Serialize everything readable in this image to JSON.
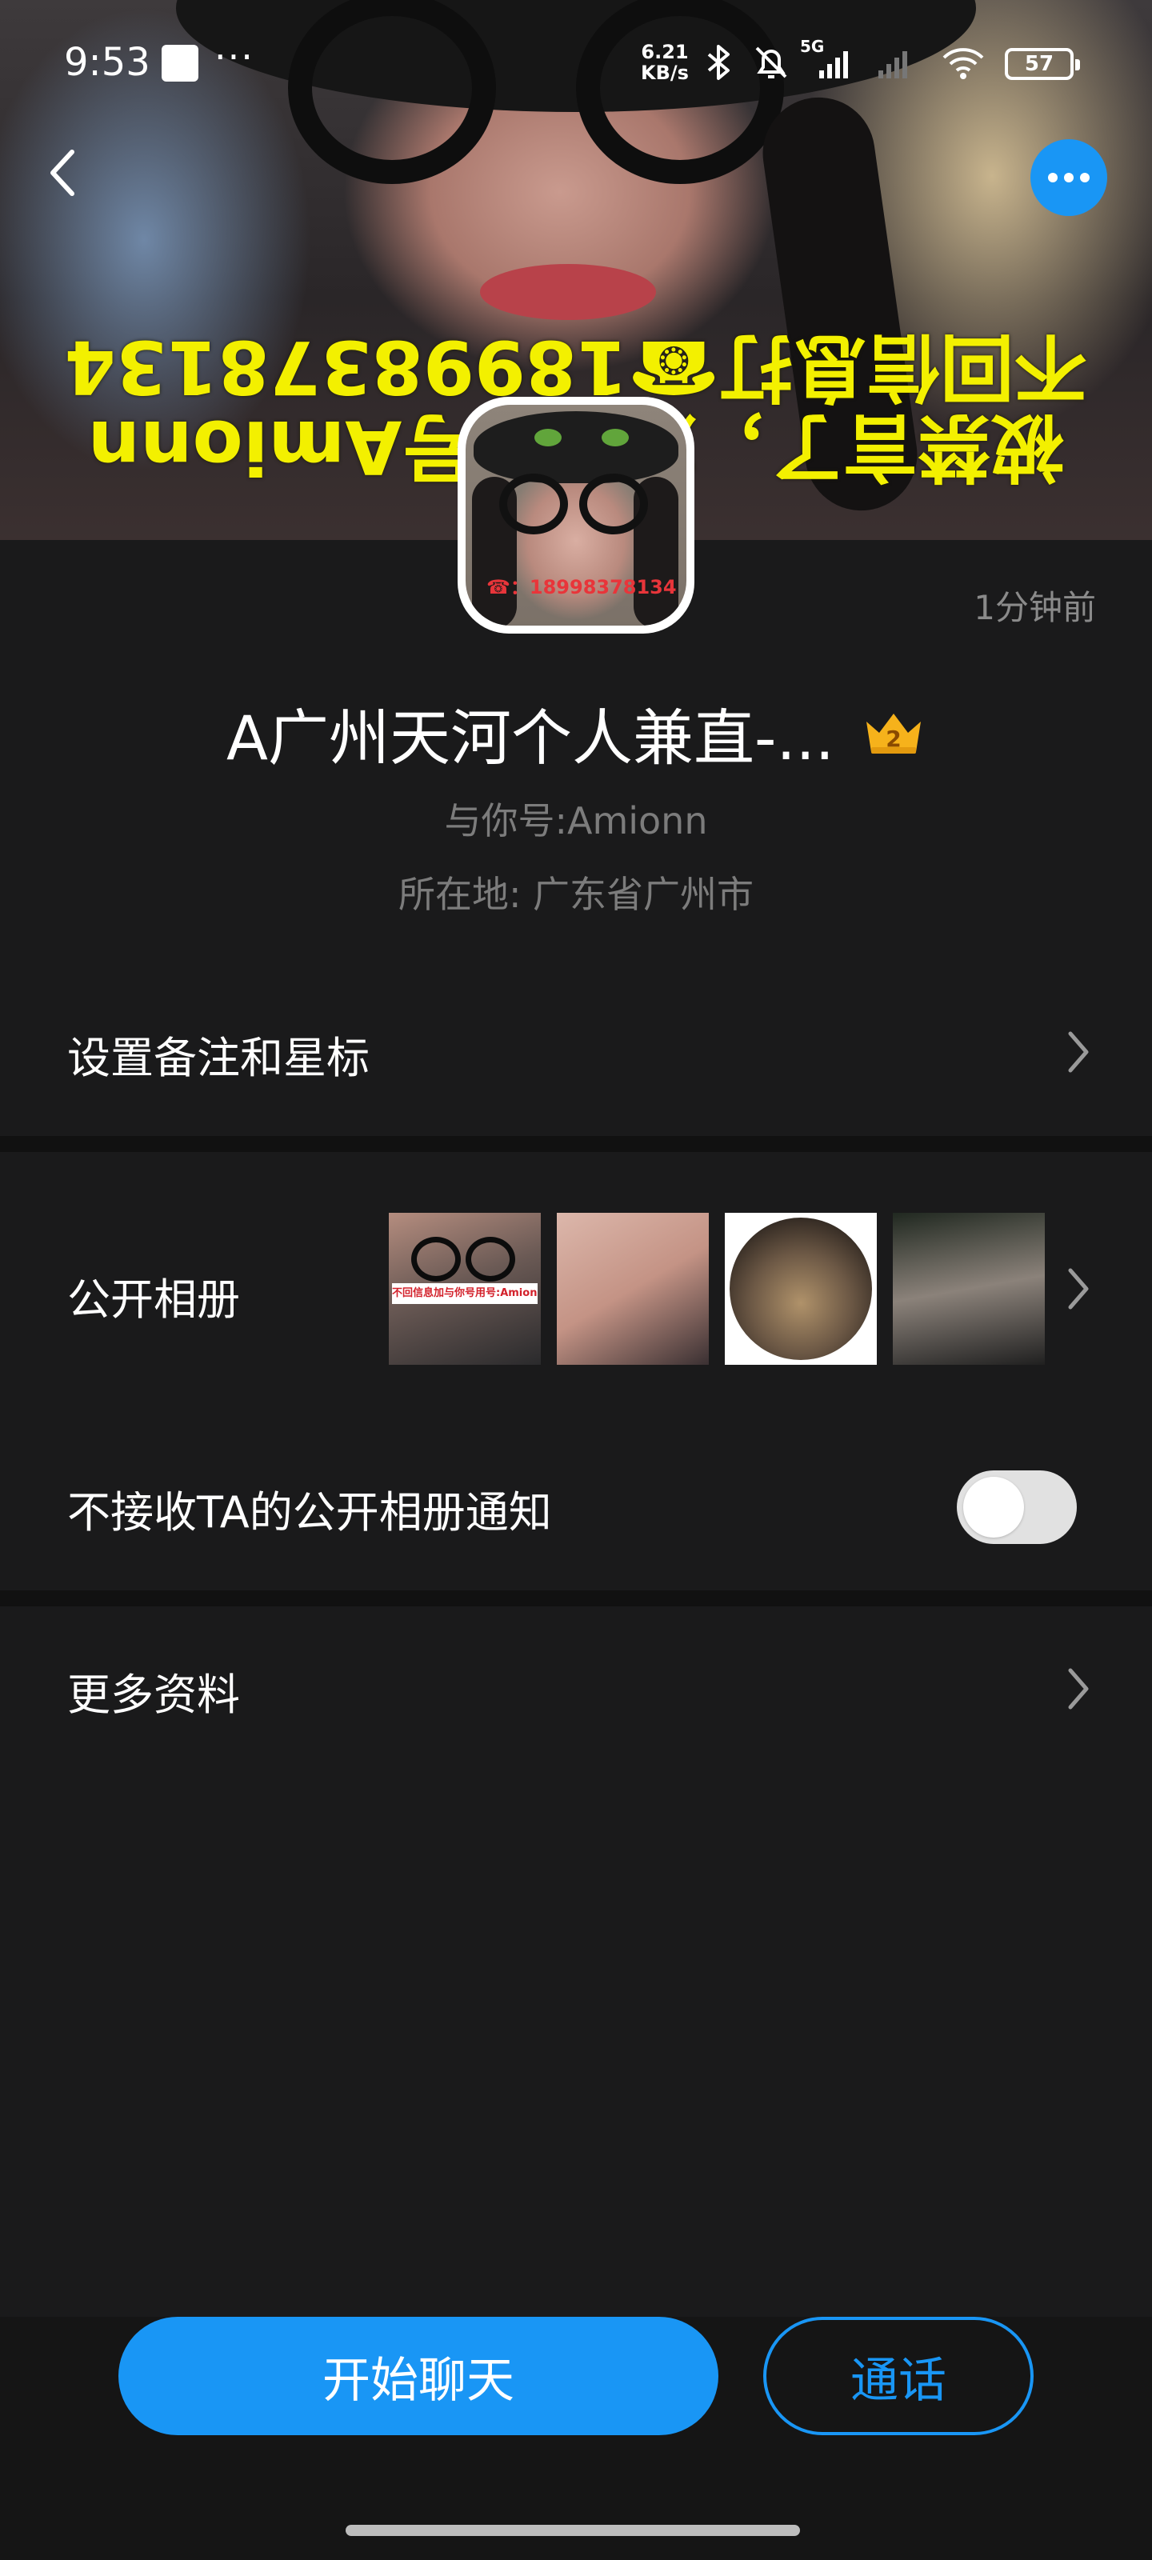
{
  "status_bar": {
    "time": "9:53",
    "dots": "···",
    "net_speed_value": "6.21",
    "net_speed_unit": "KB/s",
    "network": "5G",
    "battery": "57"
  },
  "cover": {
    "overlay_line1": "被禁言了，加与你号Amionn",
    "overlay_line2": "不回信息打☎18998378134"
  },
  "avatar": {
    "phone_tag": "☎：18998378134"
  },
  "profile": {
    "time_ago": "1分钟前",
    "name": "A广州天河个人兼直-...",
    "crown_level": "2",
    "account": "与你号:Amionn",
    "location": "所在地: 广东省广州市"
  },
  "rows": {
    "remark_star": "设置备注和星标",
    "public_album": "公开相册",
    "album_caption": "不回信息加与你号用号:Amionk",
    "mute_album": "不接收TA的公开相册通知",
    "more_info": "更多资料"
  },
  "mute_album_enabled": false,
  "actions": {
    "chat": "开始聊天",
    "call": "通话"
  },
  "colors": {
    "accent": "#1996f5",
    "background": "#1a1a1b",
    "overlay_text": "#f3f000"
  }
}
